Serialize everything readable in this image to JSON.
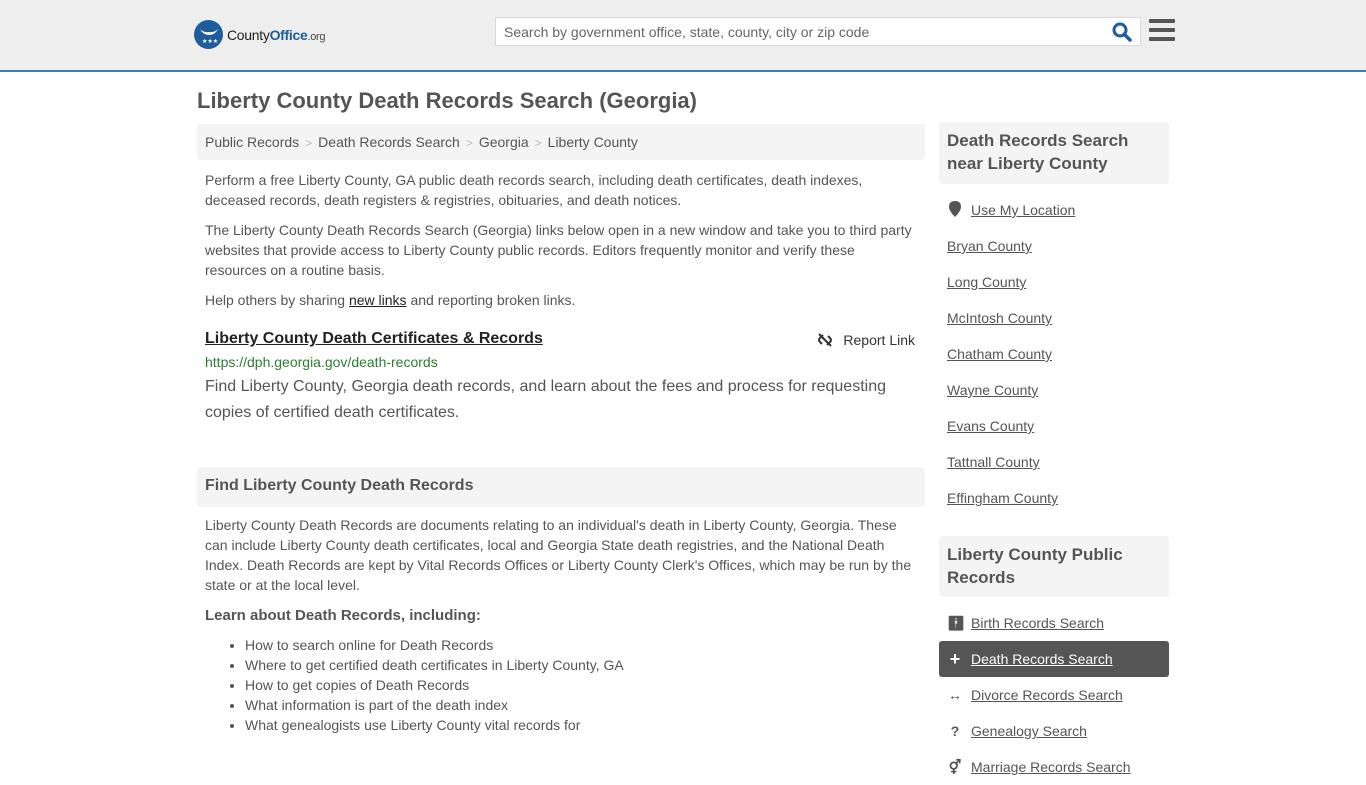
{
  "header": {
    "logo": {
      "brand_prefix": "County",
      "brand_main": "Office",
      "brand_suffix": ".org"
    },
    "search": {
      "placeholder": "Search by government office, state, county, city or zip code",
      "value": ""
    },
    "icons": {
      "search": "search-icon",
      "menu": "hamburger-menu-icon"
    }
  },
  "page": {
    "title": "Liberty County Death Records Search (Georgia)",
    "breadcrumb": [
      "Public Records",
      "Death Records Search",
      "Georgia",
      "Liberty County"
    ],
    "intro": [
      "Perform a free Liberty County, GA public death records search, including death certificates, death indexes, deceased records, death registers & registries, obituaries, and death notices.",
      "The Liberty County Death Records Search (Georgia) links below open in a new window and take you to third party websites that provide access to Liberty County public records. Editors frequently monitor and verify these resources on a routine basis."
    ],
    "share": {
      "before": "Help others by sharing ",
      "link": "new links",
      "after": " and reporting broken links."
    }
  },
  "result": {
    "title": "Liberty County Death Certificates & Records",
    "report_label": "Report Link",
    "url": "https://dph.georgia.gov/death-records",
    "description": "Find Liberty County, Georgia death records, and learn about the fees and process for requesting copies of certified death certificates."
  },
  "find_section": {
    "heading": "Find Liberty County Death Records",
    "body": "Liberty County Death Records are documents relating to an individual's death in Liberty County, Georgia. These can include Liberty County death certificates, local and Georgia State death registries, and the National Death Index. Death Records are kept by Vital Records Offices or Liberty County Clerk's Offices, which may be run by the state or at the local level.",
    "learn_heading": "Learn about Death Records, including:",
    "learn_items": [
      "How to search online for Death Records",
      "Where to get certified death certificates in Liberty County, GA",
      "How to get copies of Death Records",
      "What information is part of the death index",
      "What genealogists use Liberty County vital records for"
    ]
  },
  "sidebar": {
    "nearby_heading": "Death Records Search near Liberty County",
    "use_location": "Use My Location",
    "nearby": [
      "Bryan County",
      "Long County",
      "McIntosh County",
      "Chatham County",
      "Wayne County",
      "Evans County",
      "Tattnall County",
      "Effingham County"
    ],
    "public_heading": "Liberty County Public Records",
    "public_links": [
      {
        "label": "Birth Records Search",
        "icon": "person-icon",
        "active": false
      },
      {
        "label": "Death Records Search",
        "icon": "plus-cross-icon",
        "active": true
      },
      {
        "label": "Divorce Records Search",
        "icon": "double-arrow-icon",
        "active": false
      },
      {
        "label": "Genealogy Search",
        "icon": "question-icon",
        "active": false
      },
      {
        "label": "Marriage Records Search",
        "icon": "marriage-symbol-icon",
        "active": false
      }
    ]
  }
}
